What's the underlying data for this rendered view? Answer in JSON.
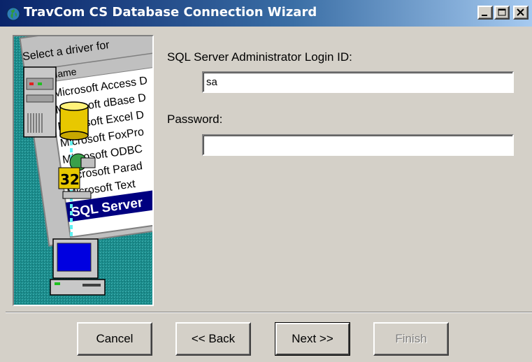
{
  "window": {
    "title": "TravCom CS Database Connection Wizard",
    "icon": "globe-icon",
    "controls": [
      "minimize-icon",
      "maximize-icon",
      "close-icon"
    ]
  },
  "side_image": {
    "dialog_caption": "Select a driver for",
    "column_header": "Name",
    "driver_list": [
      "Microsoft Access D",
      "Microsoft dBase D",
      "Microsoft Excel D",
      "Microsoft FoxPro",
      "Microsoft ODBC",
      "Microsoft Parad",
      "Microsoft Text",
      "SQL Server"
    ],
    "selected_driver": "SQL Server",
    "badge": "32",
    "colors": {
      "background": "#1a8a8a",
      "selection": "#000080"
    }
  },
  "form": {
    "login_label": "SQL Server Administrator Login ID:",
    "login_value": "sa",
    "password_label": "Password:",
    "password_value": ""
  },
  "buttons": {
    "cancel": "Cancel",
    "back": "<< Back",
    "next": "Next >>",
    "finish": "Finish"
  }
}
